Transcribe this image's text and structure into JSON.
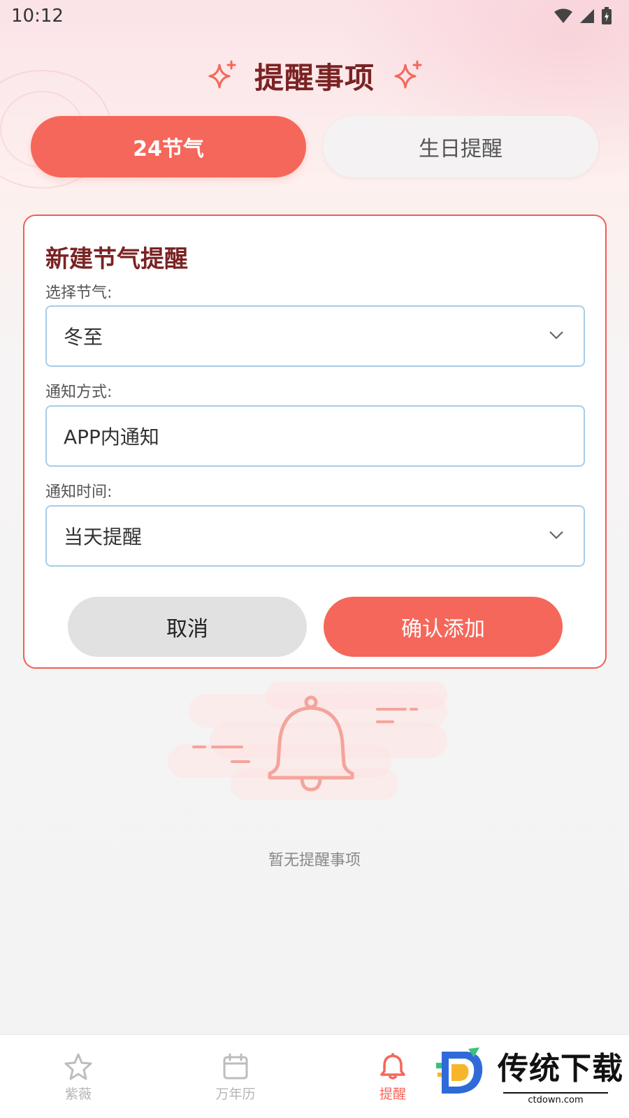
{
  "status_bar": {
    "time": "10:12"
  },
  "header": {
    "title": "提醒事项"
  },
  "tabs": [
    {
      "label": "24节气",
      "active": true
    },
    {
      "label": "生日提醒",
      "active": false
    }
  ],
  "card": {
    "title": "新建节气提醒",
    "solar_term_label": "选择节气:",
    "solar_term_value": "冬至",
    "notify_method_label": "通知方式:",
    "notify_method_value": "APP内通知",
    "notify_time_label": "通知时间:",
    "notify_time_value": "当天提醒",
    "cancel_label": "取消",
    "confirm_label": "确认添加"
  },
  "empty_state": {
    "text": "暂无提醒事项"
  },
  "bottom_nav": [
    {
      "label": "紫薇",
      "icon": "star-icon",
      "active": false
    },
    {
      "label": "万年历",
      "icon": "calendar-icon",
      "active": false
    },
    {
      "label": "提醒",
      "icon": "bell-icon",
      "active": true
    }
  ],
  "watermark": {
    "text": "传统下载",
    "sub": "ctdown.com"
  },
  "colors": {
    "accent": "#f5675a",
    "title": "#7a2323",
    "field_border": "#a8cce8"
  }
}
